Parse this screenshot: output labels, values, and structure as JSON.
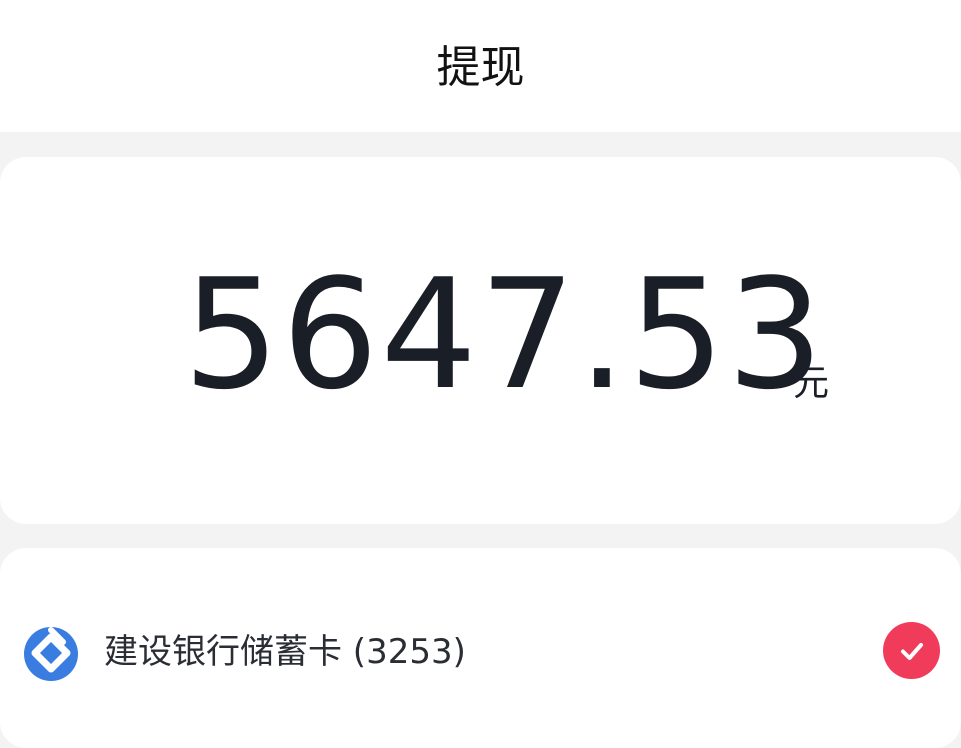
{
  "header": {
    "title": "提现"
  },
  "amount": {
    "value": "5647.53",
    "unit": "元"
  },
  "bank": {
    "name": "建设银行储蓄卡 (3253)",
    "logo_icon": "ccb-bank-logo-icon",
    "selected_icon": "check-icon",
    "selected": true
  },
  "colors": {
    "accent": "#f03c5a",
    "bank_logo": "#3a7de0",
    "background": "#f3f3f3"
  }
}
